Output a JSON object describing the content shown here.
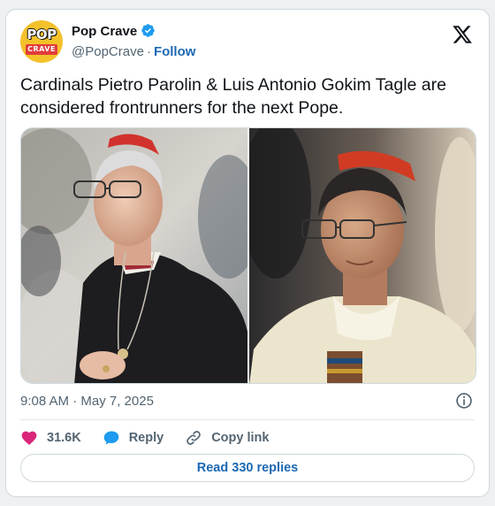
{
  "author": {
    "display_name": "Pop Crave",
    "handle": "@PopCrave",
    "follow_label": "Follow",
    "avatar_text_top": "POP",
    "avatar_text_bottom": "CRAVE"
  },
  "separator": "·",
  "tweet": {
    "text": "Cardinals Pietro Parolin & Luis Antonio Gokim Tagle are considered frontrunners for the next Pope.",
    "timestamp": "9:08 AM · May 7, 2025"
  },
  "actions": {
    "likes": "31.6K",
    "reply_label": "Reply",
    "copy_link_label": "Copy link",
    "read_replies_label": "Read 330 replies"
  },
  "colors": {
    "accent": "#1d68b4",
    "like_heart": "#d9267a",
    "verified": "#1d9bf0",
    "muted_text": "#536471"
  },
  "icons": [
    "verified-badge-icon",
    "x-logo-icon",
    "info-icon",
    "heart-icon",
    "reply-bubble-icon",
    "link-icon"
  ]
}
